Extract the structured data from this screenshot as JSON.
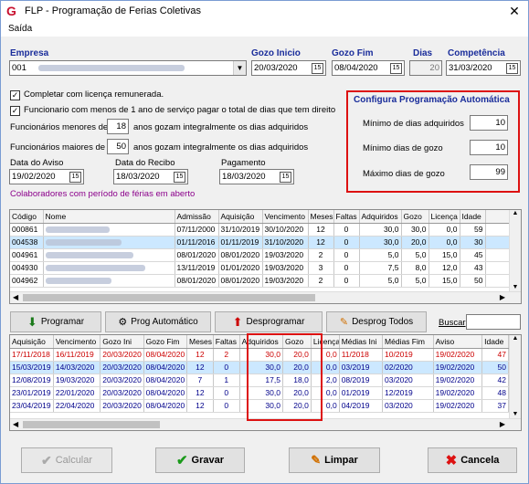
{
  "window": {
    "title": "FLP - Programação de Ferias Coletivas",
    "app_icon_letter": "G"
  },
  "menu": {
    "saida": "Saída"
  },
  "header": {
    "empresa_label": "Empresa",
    "empresa_code": "001",
    "gozo_inicio_label": "Gozo Inicio",
    "gozo_inicio": "20/03/2020",
    "gozo_fim_label": "Gozo Fim",
    "gozo_fim": "08/04/2020",
    "dias_label": "Dias",
    "dias": "20",
    "competencia_label": "Competência",
    "competencia": "31/03/2020"
  },
  "options": {
    "completar_label": "Completar com licença remunerada.",
    "funcionario_label": "Funcionario com menos de 1 ano de serviço pagar o total de dias que tem direito",
    "menores_prefix": "Funcionários menores de",
    "menores_value": "18",
    "menores_suffix": "anos gozam integralmente os dias adquiridos",
    "maiores_prefix": "Funcionários  maiores de",
    "maiores_value": "50",
    "maiores_suffix": "anos gozam integralmente os dias adquiridos",
    "aviso_label": "Data do Aviso",
    "aviso": "19/02/2020",
    "recibo_label": "Data do Recibo",
    "recibo": "18/03/2020",
    "pagamento_label": "Pagamento",
    "pagamento": "18/03/2020",
    "colab_aberto": "Colaboradores com período de férias em aberto"
  },
  "config": {
    "title": "Configura Programação Automática",
    "min_adq_label": "Mínimo de dias adquiridos",
    "min_adq": "10",
    "min_gozo_label": "Mínimo dias de gozo",
    "min_gozo": "10",
    "max_gozo_label": "Máximo dias de gozo",
    "max_gozo": "99"
  },
  "grid1": {
    "columns": [
      "Código",
      "Nome",
      "Admissão",
      "Aquisição",
      "Vencimento",
      "Meses",
      "Faltas",
      "Adquiridos",
      "Gozo",
      "Licença",
      "Idade"
    ],
    "rows": [
      [
        "000861",
        "",
        "07/11/2000",
        "31/10/2019",
        "30/10/2020",
        "12",
        "0",
        "30,0",
        "30,0",
        "0,0",
        "59"
      ],
      [
        "004538",
        "",
        "01/11/2016",
        "01/11/2019",
        "31/10/2020",
        "12",
        "0",
        "30,0",
        "20,0",
        "0,0",
        "30"
      ],
      [
        "004961",
        "",
        "08/01/2020",
        "08/01/2020",
        "19/03/2020",
        "2",
        "0",
        "5,0",
        "5,0",
        "15,0",
        "45"
      ],
      [
        "004930",
        "",
        "13/11/2019",
        "01/01/2020",
        "19/03/2020",
        "3",
        "0",
        "7,5",
        "8,0",
        "12,0",
        "43"
      ],
      [
        "004962",
        "",
        "08/01/2020",
        "08/01/2020",
        "19/03/2020",
        "2",
        "0",
        "5,0",
        "5,0",
        "15,0",
        "50"
      ]
    ]
  },
  "actions": {
    "programar": "Programar",
    "prog_auto": "Prog Automático",
    "desprogramar": "Desprogramar",
    "desprog_todos": "Desprog Todos",
    "buscar": "Buscar"
  },
  "grid2": {
    "columns": [
      "Aquisição",
      "Vencimento",
      "Gozo Ini",
      "Gozo Fim",
      "Meses",
      "Faltas",
      "Adquiridos",
      "Gozo",
      "Licença",
      "Médias Ini",
      "Médias Fim",
      "Aviso",
      "Idade"
    ],
    "rows": [
      [
        "17/11/2018",
        "16/11/2019",
        "20/03/2020",
        "08/04/2020",
        "12",
        "2",
        "30,0",
        "20,0",
        "0,0",
        "11/2018",
        "10/2019",
        "19/02/2020",
        "47"
      ],
      [
        "15/03/2019",
        "14/03/2020",
        "20/03/2020",
        "08/04/2020",
        "12",
        "0",
        "30,0",
        "20,0",
        "0,0",
        "03/2019",
        "02/2020",
        "19/02/2020",
        "50"
      ],
      [
        "12/08/2019",
        "19/03/2020",
        "20/03/2020",
        "08/04/2020",
        "7",
        "1",
        "17,5",
        "18,0",
        "2,0",
        "08/2019",
        "03/2020",
        "19/02/2020",
        "42"
      ],
      [
        "23/01/2019",
        "22/01/2020",
        "20/03/2020",
        "08/04/2020",
        "12",
        "0",
        "30,0",
        "20,0",
        "0,0",
        "01/2019",
        "12/2019",
        "19/02/2020",
        "48"
      ],
      [
        "23/04/2019",
        "22/04/2020",
        "20/03/2020",
        "08/04/2020",
        "12",
        "0",
        "30,0",
        "20,0",
        "0,0",
        "04/2019",
        "03/2020",
        "19/02/2020",
        "37"
      ]
    ]
  },
  "footer": {
    "calcular": "Calcular",
    "gravar": "Gravar",
    "limpar": "Limpar",
    "cancela": "Cancela"
  },
  "colors": {
    "accent_red": "#d11111",
    "header_blue": "#1a2d9b",
    "purple": "#8b008b",
    "selection": "#cce8ff"
  }
}
